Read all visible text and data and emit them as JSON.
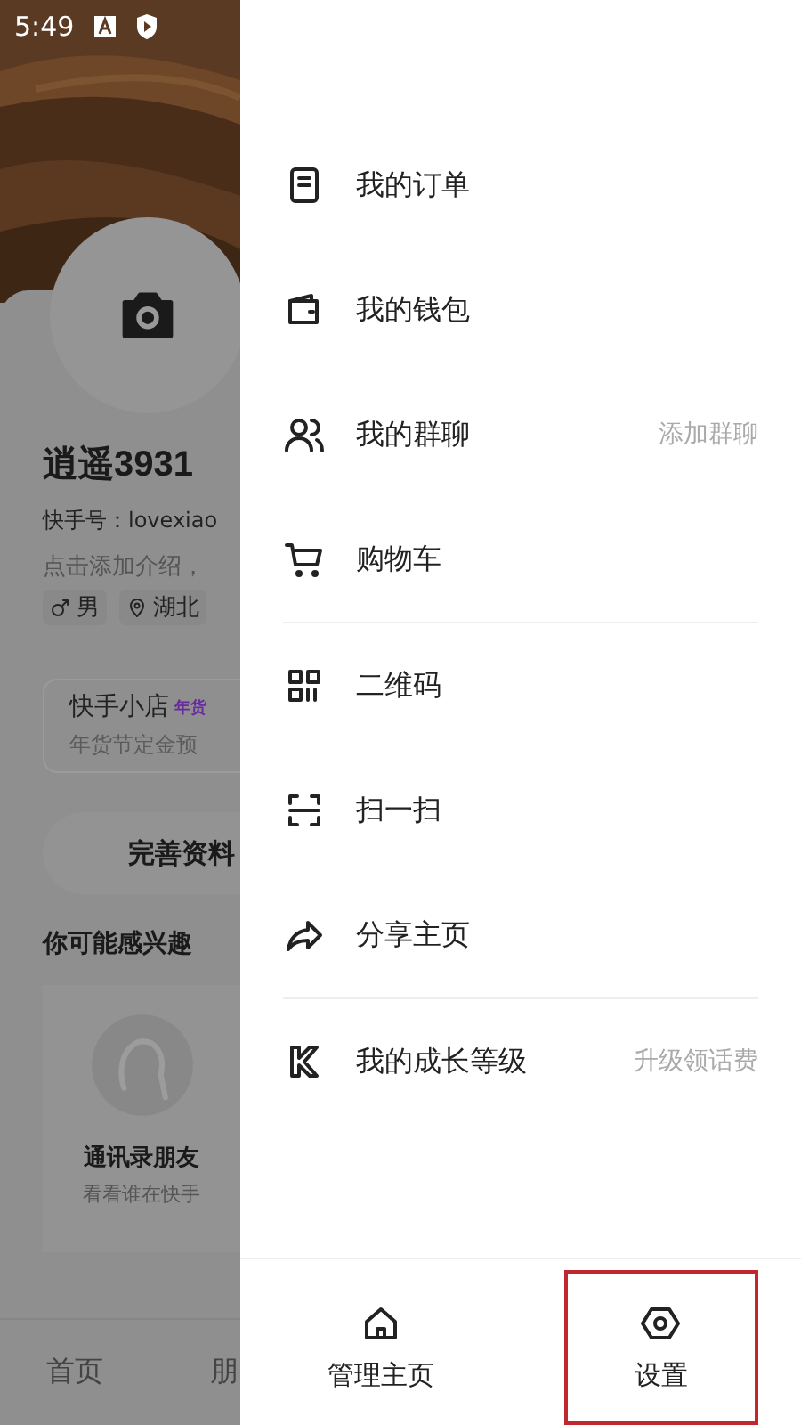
{
  "status_bar": {
    "time": "5:49"
  },
  "profile": {
    "name": "逍遥3931",
    "user_id": "快手号：lovexiao",
    "intro_placeholder": "点击添加介绍，",
    "tags": [
      {
        "kind": "gender",
        "label": "男"
      },
      {
        "kind": "location",
        "label": "湖北"
      }
    ],
    "shop": {
      "title": "快手小店",
      "badge": "年货",
      "subtitle": "年货节定金预"
    },
    "complete_button": "完善资料",
    "suggest_heading": "你可能感兴趣",
    "suggest_card": {
      "title": "通讯录朋友",
      "subtitle": "看看谁在快手"
    },
    "nav": [
      {
        "label": "首页"
      },
      {
        "label": "朋"
      }
    ]
  },
  "drawer": {
    "sections": [
      [
        {
          "kind": "order",
          "label": "我的订单"
        },
        {
          "kind": "wallet",
          "label": "我的钱包"
        },
        {
          "kind": "group",
          "label": "我的群聊",
          "hint": "添加群聊"
        },
        {
          "kind": "cart",
          "label": "购物车"
        }
      ],
      [
        {
          "kind": "qr",
          "label": "二维码"
        },
        {
          "kind": "scan",
          "label": "扫一扫"
        },
        {
          "kind": "share",
          "label": "分享主页"
        }
      ],
      [
        {
          "kind": "level",
          "label": "我的成长等级",
          "hint": "升级领话费"
        }
      ]
    ],
    "bottom_actions": [
      {
        "kind": "home",
        "label": "管理主页",
        "highlighted": false
      },
      {
        "kind": "settings",
        "label": "设置",
        "highlighted": true
      }
    ]
  }
}
